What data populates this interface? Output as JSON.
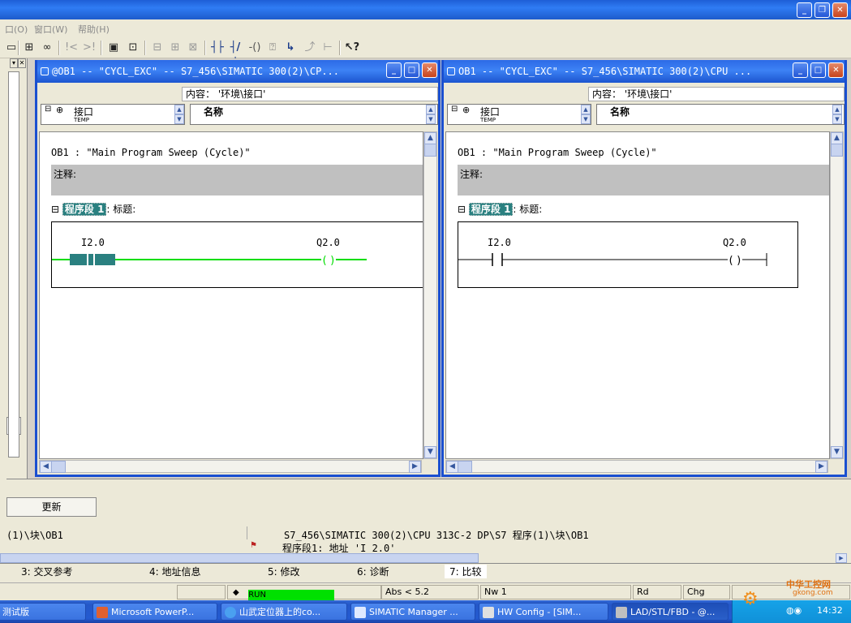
{
  "menu": {
    "items": [
      "口(O)",
      "窗口(W)",
      "帮助(H)"
    ]
  },
  "toolbar": {
    "icons": [
      "network-icon",
      "glasses-icon",
      "nav-prev-icon",
      "nav-next-icon",
      "overview-icon",
      "zoom-icon",
      "ladder-contact-no-icon",
      "ladder-contact-nc-icon",
      "ladder-coil-icon",
      "box-icon",
      "branch-open-icon",
      "branch-close-icon",
      "help-icon"
    ]
  },
  "windows": [
    {
      "title": "@OB1 -- \"CYCL_EXC\" -- S7_456\\SIMATIC 300(2)\\CP...",
      "content_label": "内容： '环境\\接口'",
      "tree_item": "接口",
      "tree_sub": "TEMP",
      "column_header": "名称",
      "ob_title": "OB1 :  \"Main Program Sweep (Cycle)\"",
      "comment_label": "注释:",
      "network_label": "程序段 1",
      "network_title": ": 标题:",
      "contact_address": "I2.0",
      "coil_address": "Q2.0",
      "status_color": "#00dd00"
    },
    {
      "title": "OB1 -- \"CYCL_EXC\" -- S7_456\\SIMATIC 300(2)\\CPU ...",
      "content_label": "内容： '环境\\接口'",
      "tree_item": "接口",
      "tree_sub": "TEMP",
      "column_header": "名称",
      "ob_title": "OB1 :  \"Main Program Sweep (Cycle)\"",
      "comment_label": "注释:",
      "network_label": "程序段 1",
      "network_title": ": 标题:",
      "contact_address": "I2.0",
      "coil_address": "Q2.0"
    }
  ],
  "bottom_panel": {
    "refresh_button": "更新",
    "path_left": "(1)\\块\\OB1",
    "path_right": "S7_456\\SIMATIC 300(2)\\CPU 313C-2 DP\\S7 程序(1)\\块\\OB1",
    "detail": "程序段1: 地址 'I         2.0'"
  },
  "tabs": [
    "3: 交叉参考",
    "4: 地址信息",
    "5: 修改",
    "6: 诊断",
    "7: 比较"
  ],
  "statusbar": {
    "run": "RUN",
    "abs": "Abs < 5.2",
    "nw": "Nw 1",
    "rd": "Rd",
    "chg": "Chg",
    "run_color": "#00e000"
  },
  "taskbar": {
    "items": [
      "测试版",
      "Microsoft PowerP...",
      "山武定位器上的co...",
      "SIMATIC Manager ...",
      "HW Config - [SIM...",
      "LAD/STL/FBD  - @..."
    ],
    "clock": "14:32",
    "watermark": "中华工控网",
    "watermark_url": "gkong.com"
  }
}
